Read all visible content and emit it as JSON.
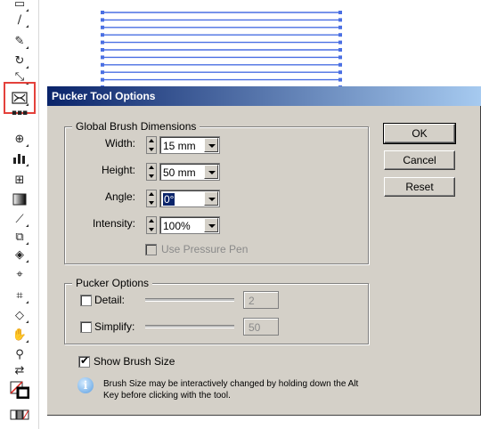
{
  "toolbar": {
    "tools": [
      "rectangle-icon",
      "paintbrush-icon",
      "pencil-icon",
      "rotate-icon",
      "scale-icon",
      "pucker-icon",
      "symbol-sprayer-icon",
      "column-graph-icon",
      "mesh-icon",
      "gradient-icon",
      "eyedropper-icon",
      "blend-icon",
      "live-paint-bucket-icon",
      "live-paint-selection-icon",
      "slice-icon",
      "eraser-icon",
      "hand-icon",
      "zoom-icon",
      "swap-colors-icon",
      "fill-stroke-icon",
      "color-mode-icon",
      "screen-mode-icon"
    ],
    "highlight_color": "#e4413b"
  },
  "artwork": {
    "line_color": "#4a6fe3",
    "line_count": 11
  },
  "dialog": {
    "title": "Pucker Tool Options",
    "title_gradient": [
      "#0a246a",
      "#a6caf0"
    ],
    "global": {
      "legend": "Global Brush Dimensions",
      "width_label": "Width:",
      "width_value": "15 mm",
      "height_label": "Height:",
      "height_value": "50 mm",
      "angle_label": "Angle:",
      "angle_value": "0°",
      "intensity_label": "Intensity:",
      "intensity_value": "100%",
      "pressure_label": "Use Pressure Pen"
    },
    "pucker": {
      "legend": "Pucker Options",
      "detail_label": "Detail:",
      "detail_value": "2",
      "simplify_label": "Simplify:",
      "simplify_value": "50"
    },
    "show_brush_size_label": "Show Brush Size",
    "show_brush_size_mark": "✔",
    "info_icon_glyph": "i",
    "info_line1": "Brush Size may be interactively changed by holding down the Alt",
    "info_line2": "Key before clicking with the tool.",
    "buttons": {
      "ok": "OK",
      "cancel": "Cancel",
      "reset": "Reset"
    }
  }
}
